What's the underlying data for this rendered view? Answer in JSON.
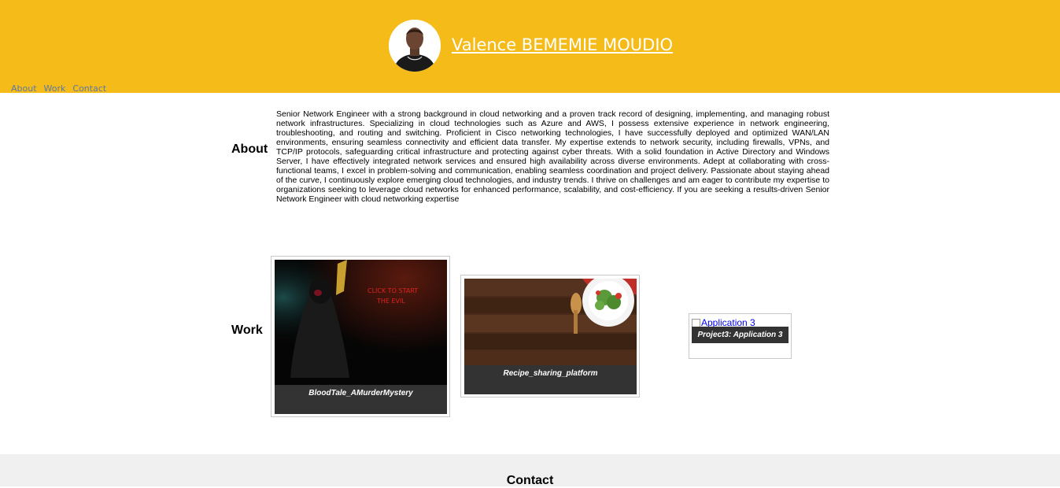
{
  "header": {
    "name": "Valence BEMEMIE MOUDIO",
    "bg_color": "#f5bb18",
    "nav": [
      "About",
      "Work",
      "Contact"
    ]
  },
  "about": {
    "heading": "About",
    "text": "Senior Network Engineer with a strong background in cloud networking and a proven track record of designing, implementing, and managing robust network infrastructures. Specializing in cloud technologies such as Azure and AWS, I possess extensive experience in network engineering, troubleshooting, and routing and switching. Proficient in Cisco networking technologies, I have successfully deployed and optimized WAN/LAN environments, ensuring seamless connectivity and efficient data transfer. My expertise extends to network security, including firewalls, VPNs, and TCP/IP protocols, safeguarding critical infrastructure and protecting against cyber threats. With a solid foundation in Active Directory and Windows Server, I have effectively integrated network services and ensured high availability across diverse environments. Adept at collaborating with cross-functional teams, I excel in problem-solving and communication, enabling seamless coordination and project delivery. Passionate about staying ahead of the curve, I continuously explore emerging cloud technologies, and industry trends. I thrive on challenges and am eager to contribute my expertise to organizations seeking to leverage cloud networks for enhanced performance, scalability, and cost-efficiency. If you are seeking a results-driven Senior Network Engineer with cloud networking expertise"
  },
  "work": {
    "heading": "Work",
    "projects": [
      {
        "caption": "BloodTale_AMurderMystery",
        "image_text": "CLICK TO START THE EVIL"
      },
      {
        "caption": "Recipe_sharing_platform"
      },
      {
        "caption": "Project3: Application 3",
        "alt_text": "Application 3"
      }
    ]
  },
  "contact": {
    "heading": "Contact"
  }
}
